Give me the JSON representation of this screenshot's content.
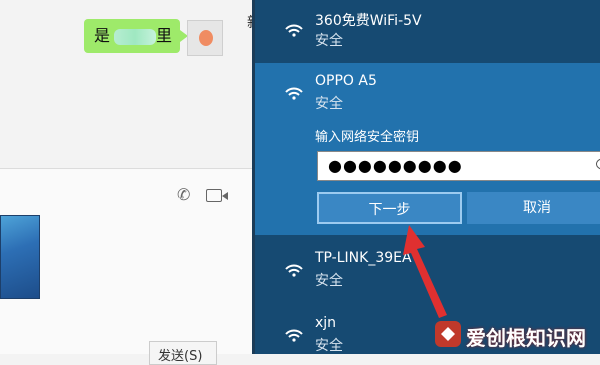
{
  "chat": {
    "message_text": "是",
    "message_tail": "里",
    "send_button": "发送(S)",
    "edge_text": "新"
  },
  "wifi": {
    "networks": [
      {
        "name": "360免费WiFi-5V",
        "status": "安全"
      },
      {
        "name": "OPPO A5",
        "status": "安全"
      },
      {
        "name": "TP-LINK_39EA",
        "status": "安全"
      },
      {
        "name": "xjn",
        "status": "安全"
      }
    ],
    "password_label": "输入网络安全密钥",
    "password_value": "●●●●●●●●●",
    "next_button": "下一步",
    "cancel_button": "取消"
  },
  "watermark": {
    "text": "爱创根知识网"
  },
  "colors": {
    "panel_bg": "#164a72",
    "expanded_bg": "#2272ad",
    "button_bg": "#3a87c4",
    "bubble_green": "#9eea6a",
    "arrow_red": "#e03030"
  },
  "icons": [
    "phone-icon",
    "video-call-icon",
    "wifi-icon",
    "eye-icon",
    "arrow-annotation-icon"
  ]
}
